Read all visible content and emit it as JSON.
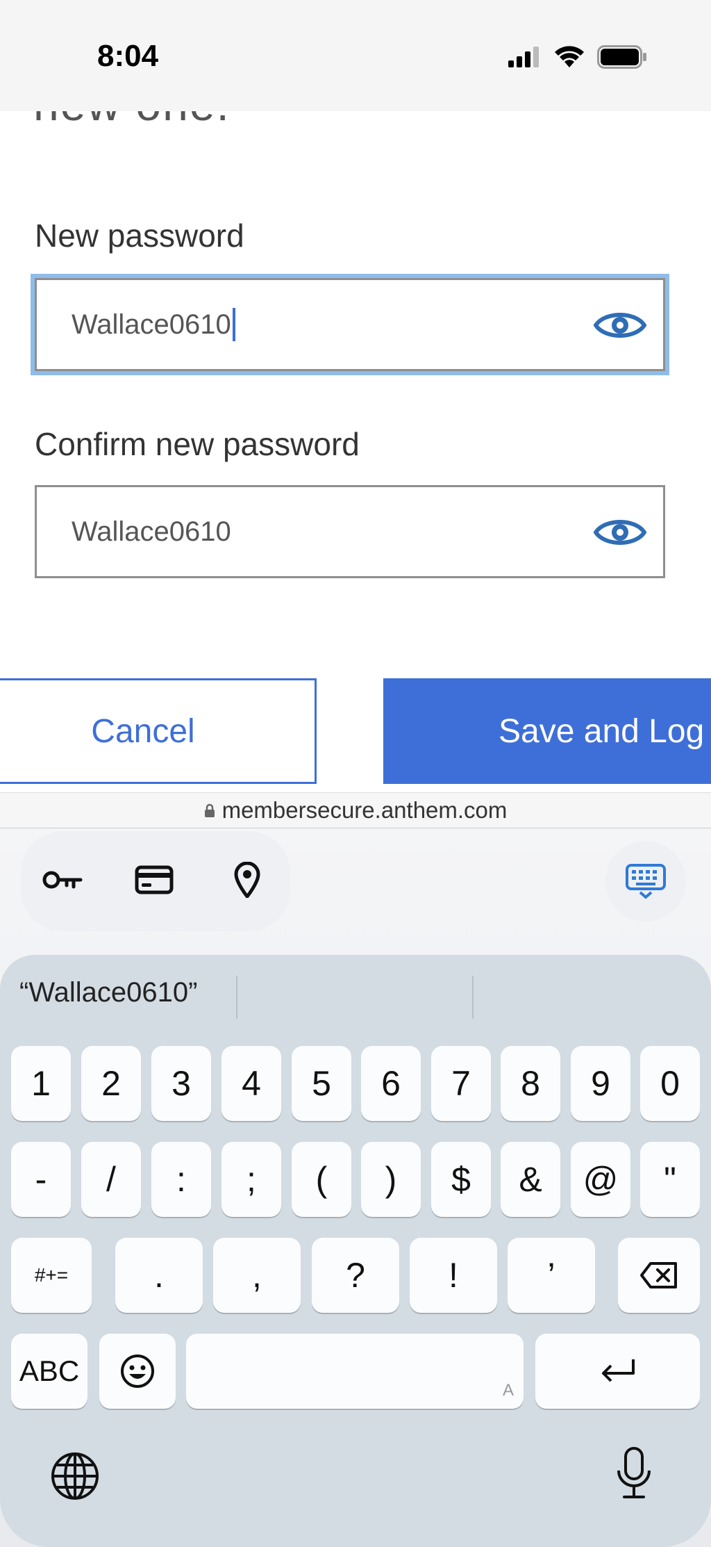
{
  "status": {
    "time": "8:04"
  },
  "page": {
    "partial_heading": "new one.",
    "new_password_label": "New password",
    "new_password_value": "Wallace0610",
    "confirm_password_label": "Confirm new password",
    "confirm_password_value": "Wallace0610",
    "cancel_label": "Cancel",
    "save_label": "Save and Log In"
  },
  "browser": {
    "url": "membersecure.anthem.com"
  },
  "keyboard": {
    "suggestion": "“Wallace0610”",
    "row1": [
      "1",
      "2",
      "3",
      "4",
      "5",
      "6",
      "7",
      "8",
      "9",
      "0"
    ],
    "row2": [
      "-",
      "/",
      ":",
      ";",
      "(",
      ")",
      "$",
      "&",
      "@",
      "\""
    ],
    "row3": [
      "#+=",
      ".",
      ",",
      "?",
      "!",
      "’"
    ],
    "abc_label": "ABC",
    "space_mark": "A"
  },
  "colors": {
    "accent": "#3e6fd9",
    "focus_ring": "#8fbce9",
    "eye": "#2f6db5",
    "keyboard_bg": "#d3dbe3"
  }
}
